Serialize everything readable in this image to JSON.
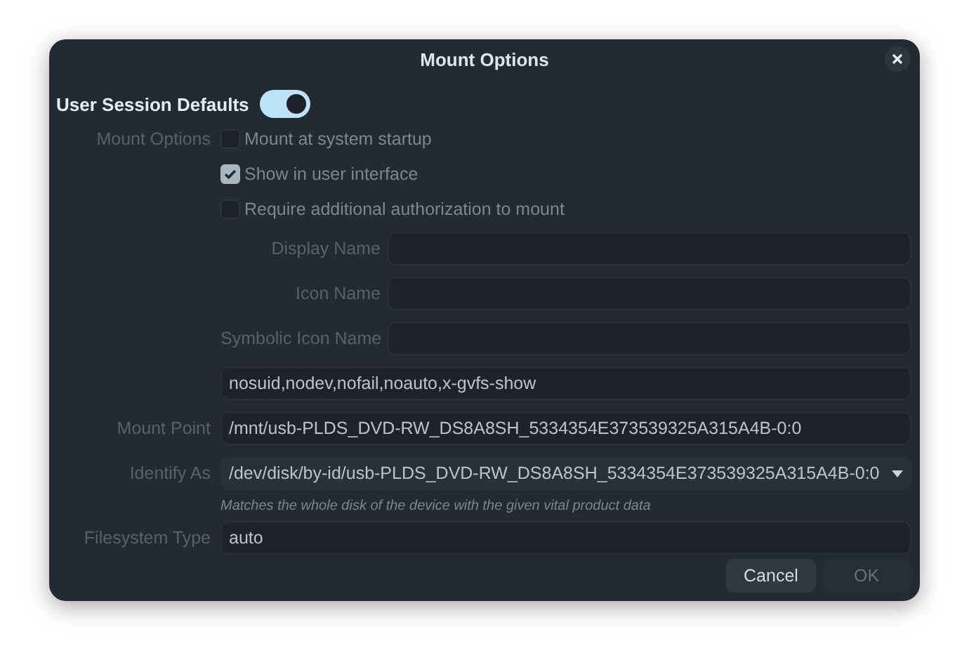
{
  "window": {
    "title": "Mount Options"
  },
  "user_session_defaults": {
    "label": "User Session Defaults",
    "on": true
  },
  "options_disabled": true,
  "mount_options": {
    "label": "Mount Options",
    "checkboxes": [
      {
        "label": "Mount at system startup",
        "checked": false
      },
      {
        "label": "Show in user interface",
        "checked": true
      },
      {
        "label": "Require additional authorization to mount",
        "checked": false
      }
    ]
  },
  "name_fields": [
    {
      "label": "Display Name"
    },
    {
      "label": "Icon Name"
    },
    {
      "label": "Symbolic Icon Name"
    }
  ],
  "options_string": {
    "value": "nosuid,nodev,nofail,noauto,x-gvfs-show"
  },
  "mount_point": {
    "label": "Mount Point",
    "value": "/mnt/usb-PLDS_DVD-RW_DS8A8SH_5334354E373539325A315A4B-0:0"
  },
  "identify_as": {
    "label": "Identify As",
    "value": "/dev/disk/by-id/usb-PLDS_DVD-RW_DS8A8SH_5334354E373539325A315A4B-0:0",
    "hint": "Matches the whole disk of the device with the given vital product data"
  },
  "filesystem_type": {
    "label": "Filesystem Type",
    "value": "auto"
  },
  "buttons": [
    {
      "label": "Cancel",
      "disabled": false
    },
    {
      "label": "OK",
      "disabled": true
    }
  ]
}
